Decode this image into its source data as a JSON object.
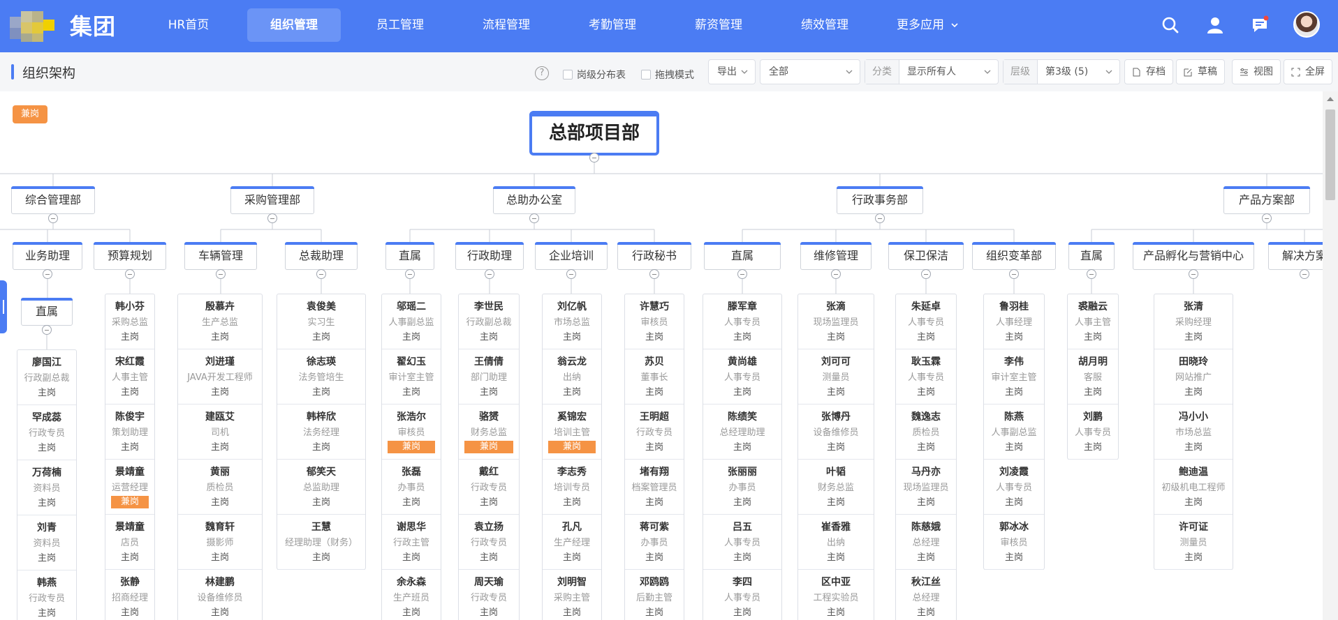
{
  "nav": {
    "logo_text": "集团",
    "items": [
      {
        "label": "HR首页"
      },
      {
        "label": "组织管理"
      },
      {
        "label": "员工管理"
      },
      {
        "label": "流程管理"
      },
      {
        "label": "考勤管理"
      },
      {
        "label": "薪资管理"
      },
      {
        "label": "绩效管理"
      },
      {
        "label": "更多应用"
      }
    ]
  },
  "toolbar": {
    "page_title": "组织架构",
    "help": "?",
    "chk_distribution": "岗级分布表",
    "chk_drag": "拖拽模式",
    "export": "导出",
    "scope": "全部",
    "class_label": "分类",
    "class_value": "显示所有人",
    "level_label": "层级",
    "level_value": "第3级 (5)",
    "archive": "存档",
    "draft": "草稿",
    "view": "视图",
    "fullscreen": "全屏"
  },
  "legend_tag": "兼岗",
  "tree": {
    "root": "总部项目部",
    "level1": [
      "综合管理部",
      "采购管理部",
      "总助办公室",
      "行政事务部",
      "产品方案部"
    ],
    "level2": [
      "业务助理",
      "预算规划",
      "车辆管理",
      "总裁助理",
      "直属",
      "行政助理",
      "企业培训",
      "行政秘书",
      "直属",
      "维修管理",
      "保卫保洁",
      "组织变革部",
      "直属",
      "产品孵化与营销中心",
      "解决方案"
    ],
    "level3": [
      "直属"
    ]
  },
  "columns": [
    {
      "people": [
        [
          "廖国江",
          "行政副总裁",
          "主岗"
        ],
        [
          "罕成蕊",
          "行政专员",
          "主岗"
        ],
        [
          "万荷楠",
          "资料员",
          "主岗"
        ],
        [
          "刘青",
          "资料员",
          "主岗"
        ],
        [
          "韩燕",
          "行政专员",
          "主岗"
        ]
      ]
    },
    {
      "people": [
        [
          "韩小芬",
          "采购总监",
          "主岗"
        ],
        [
          "宋红霞",
          "人事主管",
          "主岗"
        ],
        [
          "陈俊宇",
          "策划助理",
          "主岗"
        ],
        [
          "景靖童",
          "运营经理",
          "兼岗"
        ],
        [
          "景靖童",
          "店员",
          "主岗"
        ],
        [
          "张静",
          "招商经理",
          "主岗"
        ]
      ]
    },
    {
      "people": [
        [
          "殷慕卉",
          "生产总监",
          "主岗"
        ],
        [
          "刘进瑾",
          "JAVA开发工程师",
          "主岗"
        ],
        [
          "建瓯艾",
          "司机",
          "主岗"
        ],
        [
          "黄丽",
          "质检员",
          "主岗"
        ],
        [
          "魏育轩",
          "摄影师",
          "主岗"
        ],
        [
          "林建鹏",
          "设备维修员",
          "主岗"
        ]
      ]
    },
    {
      "people": [
        [
          "袁俊美",
          "实习生",
          "主岗"
        ],
        [
          "徐志瑛",
          "法务管培生",
          "主岗"
        ],
        [
          "韩梓欣",
          "法务经理",
          "主岗"
        ],
        [
          "郁笑天",
          "总监助理",
          "主岗"
        ],
        [
          "王慧",
          "经理助理（财务）",
          "主岗"
        ]
      ]
    },
    {
      "people": [
        [
          "邬瑶二",
          "人事副总监",
          "主岗"
        ],
        [
          "翟幻玉",
          "审计室主管",
          "主岗"
        ],
        [
          "张浩尔",
          "审核员",
          "兼岗"
        ],
        [
          "张磊",
          "办事员",
          "主岗"
        ],
        [
          "谢思华",
          "行政主管",
          "主岗"
        ],
        [
          "余永森",
          "生产班员",
          "主岗"
        ]
      ]
    },
    {
      "people": [
        [
          "李世民",
          "行政副总裁",
          "主岗"
        ],
        [
          "王倩倩",
          "部门助理",
          "主岗"
        ],
        [
          "骆赟",
          "财务总监",
          "兼岗"
        ],
        [
          "戴红",
          "行政专员",
          "主岗"
        ],
        [
          "袁立扬",
          "行政专员",
          "主岗"
        ],
        [
          "周天瑜",
          "行政专员",
          "主岗"
        ]
      ]
    },
    {
      "people": [
        [
          "刘亿帆",
          "市场总监",
          "主岗"
        ],
        [
          "翁云龙",
          "出纳",
          "主岗"
        ],
        [
          "奚锦宏",
          "培训主管",
          "兼岗"
        ],
        [
          "李志秀",
          "培训专员",
          "主岗"
        ],
        [
          "孔凡",
          "生产经理",
          "主岗"
        ],
        [
          "刘明智",
          "采购主管",
          "主岗"
        ]
      ]
    },
    {
      "people": [
        [
          "许慧巧",
          "审核员",
          "主岗"
        ],
        [
          "苏贝",
          "董事长",
          "主岗"
        ],
        [
          "王明超",
          "行政专员",
          "主岗"
        ],
        [
          "堵有翔",
          "档案管理员",
          "主岗"
        ],
        [
          "蒋可紫",
          "办事员",
          "主岗"
        ],
        [
          "邓鸥鸥",
          "后勤主管",
          "主岗"
        ]
      ]
    },
    {
      "people": [
        [
          "滕军章",
          "人事专员",
          "主岗"
        ],
        [
          "黄尚雄",
          "人事专员",
          "主岗"
        ],
        [
          "陈绩笑",
          "总经理助理",
          "主岗"
        ],
        [
          "张丽丽",
          "办事员",
          "主岗"
        ],
        [
          "吕五",
          "人事专员",
          "主岗"
        ],
        [
          "李四",
          "人事专员",
          "主岗"
        ]
      ]
    },
    {
      "people": [
        [
          "张滴",
          "现场监理员",
          "主岗"
        ],
        [
          "刘可可",
          "测量员",
          "主岗"
        ],
        [
          "张博丹",
          "设备维修员",
          "主岗"
        ],
        [
          "叶韬",
          "财务总监",
          "主岗"
        ],
        [
          "崔香雅",
          "出纳",
          "主岗"
        ],
        [
          "区中亚",
          "工程实验员",
          "主岗"
        ]
      ]
    },
    {
      "people": [
        [
          "朱延卓",
          "人事专员",
          "主岗"
        ],
        [
          "耿玉霖",
          "人事专员",
          "主岗"
        ],
        [
          "魏逸志",
          "质检员",
          "主岗"
        ],
        [
          "马丹亦",
          "现场监理员",
          "主岗"
        ],
        [
          "陈慈娥",
          "总经理",
          "主岗"
        ],
        [
          "秋江丝",
          "总经理",
          "主岗"
        ]
      ]
    },
    {
      "people": [
        [
          "鲁羽桂",
          "人事经理",
          "主岗"
        ],
        [
          "李伟",
          "审计室主管",
          "主岗"
        ],
        [
          "陈燕",
          "人事副总监",
          "主岗"
        ],
        [
          "刘凌霞",
          "人事专员",
          "主岗"
        ],
        [
          "郭冰冰",
          "审核员",
          "主岗"
        ]
      ]
    },
    {
      "people": [
        [
          "裘融云",
          "人事主管",
          "主岗"
        ],
        [
          "胡月明",
          "客服",
          "主岗"
        ],
        [
          "刘鹏",
          "人事专员",
          "主岗"
        ]
      ]
    },
    {
      "people": [
        [
          "张清",
          "采购经理",
          "主岗"
        ],
        [
          "田晓玲",
          "网站推广",
          "主岗"
        ],
        [
          "冯小小",
          "市场总监",
          "主岗"
        ],
        [
          "鲍迪温",
          "初级机电工程师",
          "主岗"
        ],
        [
          "许可证",
          "测量员",
          "主岗"
        ]
      ]
    }
  ],
  "colors": {
    "primary": "#4b7cf3",
    "tag": "#f59344",
    "nav_active": "#6b94f6"
  }
}
